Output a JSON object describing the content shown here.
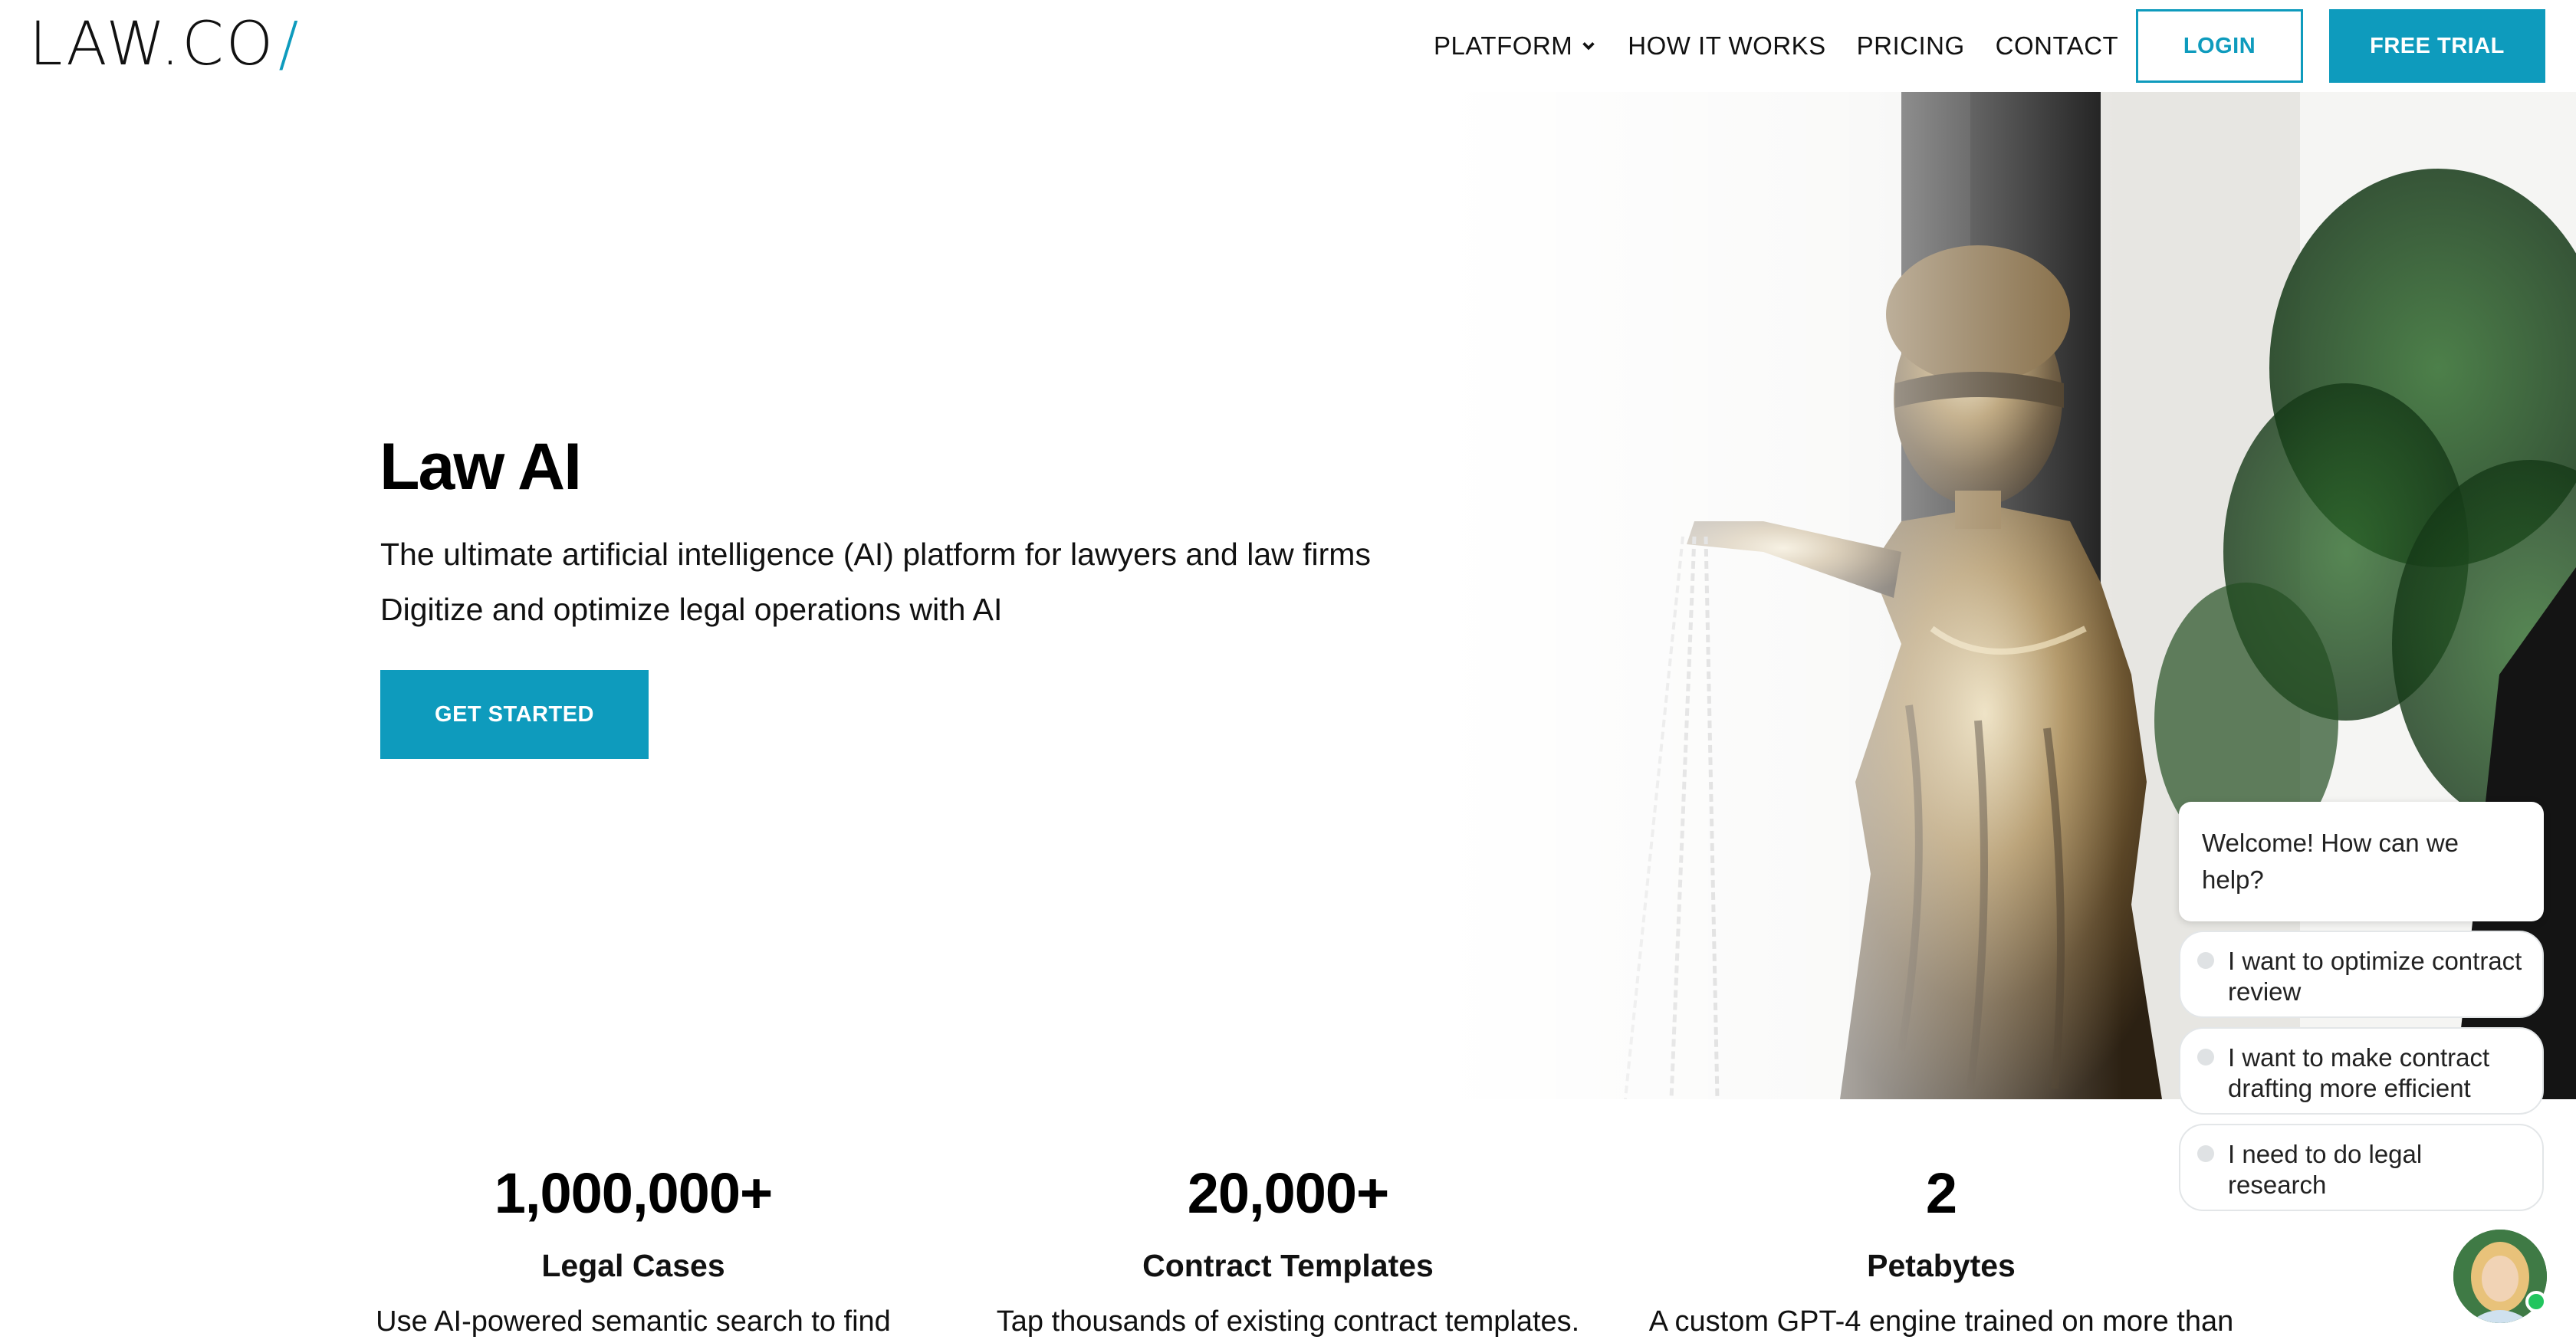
{
  "header": {
    "logo_text": "LAW.CO",
    "logo_slash": "/",
    "nav": [
      {
        "label": "PLATFORM",
        "has_dropdown": true
      },
      {
        "label": "HOW IT WORKS"
      },
      {
        "label": "PRICING"
      },
      {
        "label": "CONTACT"
      }
    ],
    "login_label": "LOGIN",
    "trial_label": "FREE TRIAL",
    "accent_color": "#0e9bbd"
  },
  "hero": {
    "title": "Law AI",
    "line1": "The ultimate artificial intelligence (AI) platform for lawyers and law firms",
    "line2": "Digitize and optimize legal operations with AI",
    "cta_label": "GET STARTED",
    "image": "lady-justice-statue"
  },
  "stats": [
    {
      "number": "1,000,000+",
      "label": "Legal Cases",
      "desc": "Use AI-powered semantic search to find"
    },
    {
      "number": "20,000+",
      "label": "Contract Templates",
      "desc": "Tap thousands of existing contract templates."
    },
    {
      "number": "2",
      "label": "Petabytes",
      "desc": "A custom GPT-4 engine trained on more than"
    }
  ],
  "chat": {
    "greeting": "Welcome! How can we help?",
    "options": [
      "I want to optimize contract review",
      "I want to make contract drafting more efficient",
      "I need to do legal research"
    ],
    "avatar": "agent-avatar",
    "status_color": "#22c55e"
  }
}
